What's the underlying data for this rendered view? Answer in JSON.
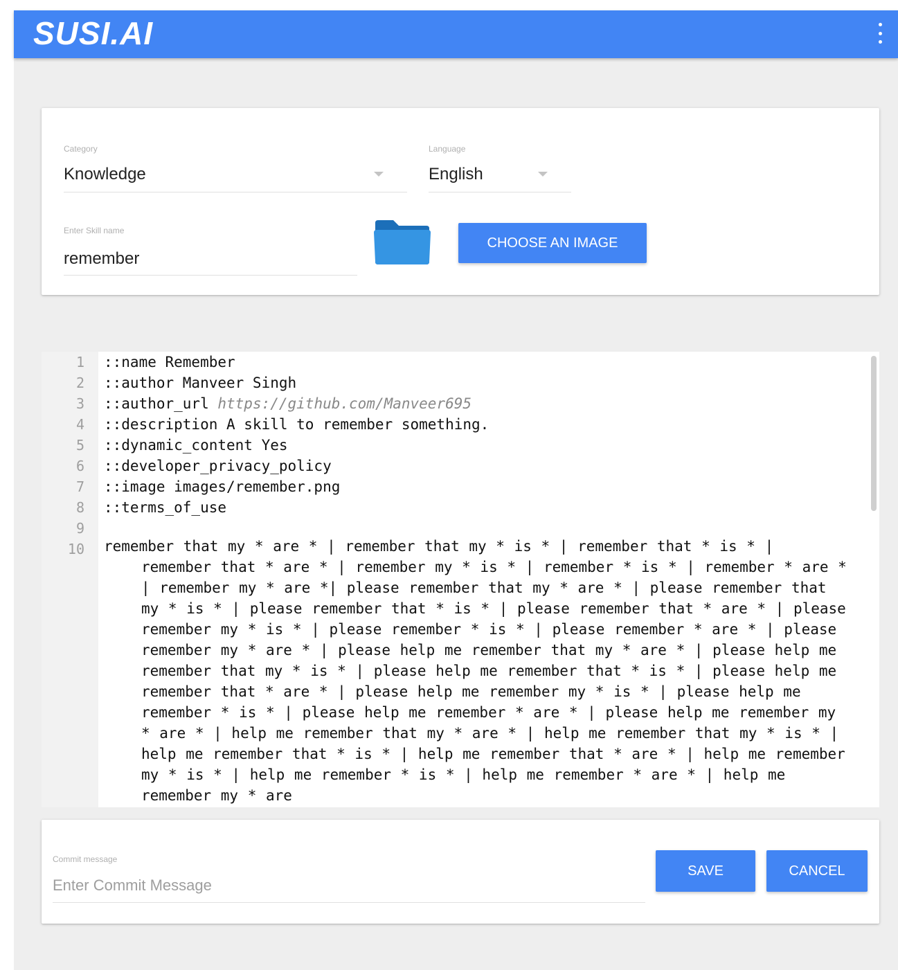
{
  "app": {
    "logo": "SUSI.AI"
  },
  "header": {
    "menu_icon": "more-vert-icon"
  },
  "form": {
    "category": {
      "label": "Category",
      "value": "Knowledge"
    },
    "language": {
      "label": "Language",
      "value": "English"
    },
    "skill_name": {
      "label": "Enter Skill name",
      "value": "remember"
    },
    "folder_icon": "folder-icon",
    "choose_image_label": "CHOOSE AN IMAGE"
  },
  "editor": {
    "line_numbers": [
      "1",
      "2",
      "3",
      "4",
      "5",
      "6",
      "7",
      "8",
      "9",
      "10"
    ],
    "lines": [
      "::name Remember",
      "::author Manveer Singh",
      "::author_url ",
      "::description A skill to remember something.",
      "::dynamic_content Yes",
      "::developer_privacy_policy",
      "::image images/remember.png",
      "::terms_of_use",
      ""
    ],
    "url_text": "https://github.com/Manveer695",
    "line10_first": "remember that my * are * | remember that my * is * | remember that * is * |",
    "line10_rest": "remember that * are * | remember my * is * | remember * is * | remember * are * | remember my * are *| please remember that my * are * | please remember that my * is * | please remember that * is * | please remember that * are * | please remember my * is * | please remember * is * | please remember * are * | please remember my * are * | please help me remember that my * are * | please help me remember that my * is * | please help me remember that * is * | please help me remember that * are * | please help me remember my * is * | please help me remember * is * | please help me remember * are * | please help me remember my * are * | help me remember that my * are * | help me remember that my * is * | help me remember that * is * | help me remember that * are * | help me remember my * is * | help me remember * is * | help me remember * are * | help me remember my * are"
  },
  "commit": {
    "label": "Commit message",
    "placeholder": "Enter Commit Message",
    "save_label": "SAVE",
    "cancel_label": "CANCEL"
  }
}
